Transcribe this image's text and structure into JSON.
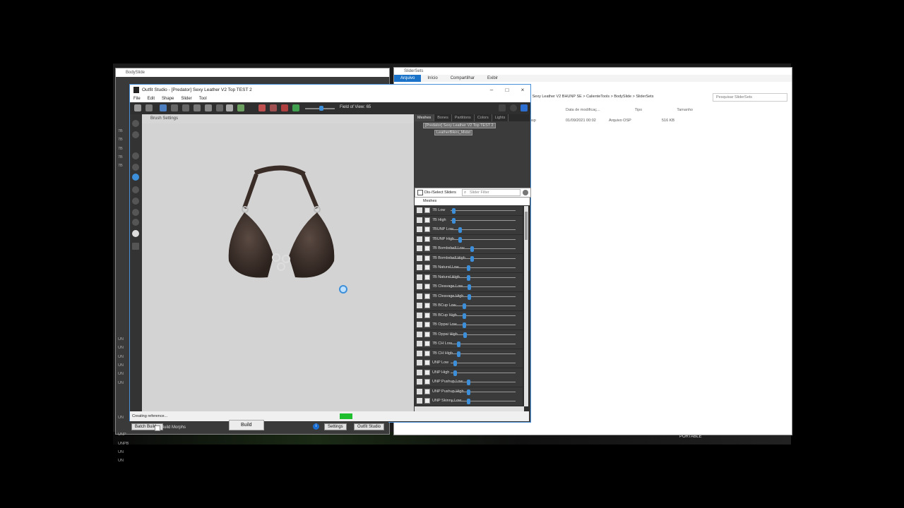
{
  "desktop": {
    "portable_label": "PORTABLE"
  },
  "explorer": {
    "title": "SliderSets",
    "ribbon": [
      "Arquivo",
      "Início",
      "Compartilhar",
      "Exibir"
    ],
    "address": "dator] Sexy Leather V2 BHUNP SE  >  CalienteTools  >  BodySlide  >  SliderSets",
    "search_placeholder": "Pesquisar SliderSets",
    "columns": [
      "Data de modificaç...",
      "Tipo",
      "Tamanho"
    ],
    "row": {
      "name": "osp",
      "date": "01/09/2021 00:02",
      "type": "Arquivo OSP",
      "size": "516 KB"
    }
  },
  "bodyslide": {
    "title": "BodySlide",
    "side_labels": [
      "7B",
      "7B",
      "7B",
      "7B",
      "7B",
      "",
      "",
      "",
      "",
      "",
      "",
      "",
      "",
      "",
      "",
      "",
      "",
      "",
      "",
      "",
      "",
      "",
      "",
      "",
      "UN",
      "UN",
      "UN",
      "UN",
      "UN",
      "UN",
      "",
      "",
      "",
      "UN",
      "",
      "UNP",
      "UNPB",
      "UN",
      "UN"
    ],
    "batch_build": "Batch Build...",
    "build_morphs": "Build Morphs",
    "build": "Build",
    "settings": "Settings",
    "outfit_studio": "Outfit Studio"
  },
  "outfit_studio": {
    "title": "Outfit Studio - [Predator] Sexy Leather V2 Top TEST 2",
    "menu": [
      "File",
      "Edit",
      "Shape",
      "Slider",
      "Tool"
    ],
    "field_of_view": "Field of View: 65",
    "brush_settings": "Brush Settings",
    "tabs": [
      "Meshes",
      "Bones",
      "Partitions",
      "Colors",
      "Lights"
    ],
    "tree": {
      "root": "[Predator] Sexy Leather V2 Top TEST 2",
      "child": "LeatherBikini_Midst"
    },
    "slider_bar": {
      "toggle_label": "Dis-/Select Sliders",
      "filter_placeholder": "Slider Filter"
    },
    "meshes_header": "Meshes",
    "sliders": [
      {
        "name": "7B Low",
        "value": 0.02
      },
      {
        "name": "7B High",
        "value": 0.02
      },
      {
        "name": "7BUNP Low",
        "value": 0.12
      },
      {
        "name": "7BUNP High",
        "value": 0.12
      },
      {
        "name": "7B Bombshell Low",
        "value": 0.3
      },
      {
        "name": "7B Bombshell High",
        "value": 0.3
      },
      {
        "name": "7B Natural Low",
        "value": 0.25
      },
      {
        "name": "7B Natural High",
        "value": 0.25
      },
      {
        "name": "7B Cleavage Low",
        "value": 0.26
      },
      {
        "name": "7B Cleavage High",
        "value": 0.26
      },
      {
        "name": "7B BCup Low",
        "value": 0.18
      },
      {
        "name": "7B BCup High",
        "value": 0.18
      },
      {
        "name": "7B Oppai Low",
        "value": 0.18
      },
      {
        "name": "7B Oppai High",
        "value": 0.2
      },
      {
        "name": "7B CH Low",
        "value": 0.1
      },
      {
        "name": "7B CH High",
        "value": 0.1
      },
      {
        "name": "UNP Low",
        "value": 0.04
      },
      {
        "name": "UNP High",
        "value": 0.04
      },
      {
        "name": "UNP Pushup Low",
        "value": 0.25
      },
      {
        "name": "UNP Pushup High",
        "value": 0.25
      },
      {
        "name": "UNP Skinny Low",
        "value": 0.25
      }
    ],
    "status_text": "Creating reference..."
  }
}
